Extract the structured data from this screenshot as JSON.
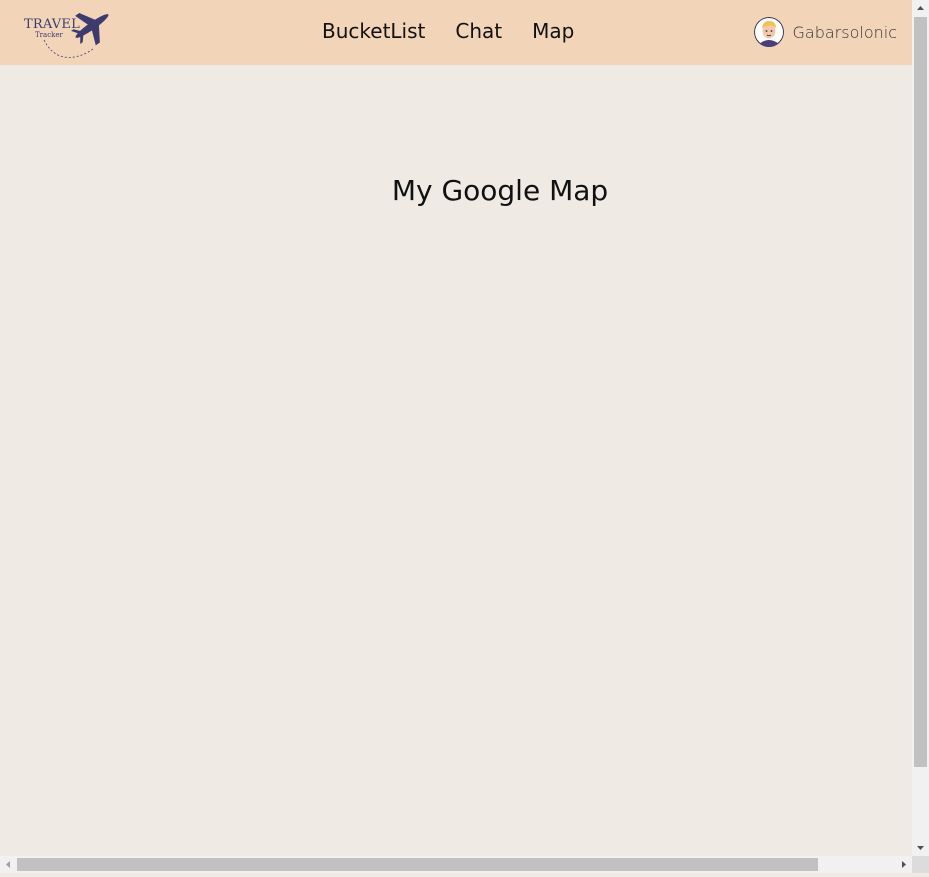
{
  "navbar": {
    "logo": {
      "title": "TRAVEL",
      "subtitle": "Tracker",
      "icon": "airplane-icon"
    },
    "links": [
      {
        "label": "BucketList"
      },
      {
        "label": "Chat"
      },
      {
        "label": "Map"
      }
    ],
    "user": {
      "avatar_icon": "user-avatar-icon",
      "name": "Gabarsolonic"
    }
  },
  "main": {
    "title": "My Google Map"
  },
  "colors": {
    "navbar_bg": "#f2d5b8",
    "page_bg": "#efebe4",
    "logo_accent": "#3d3a6e"
  }
}
